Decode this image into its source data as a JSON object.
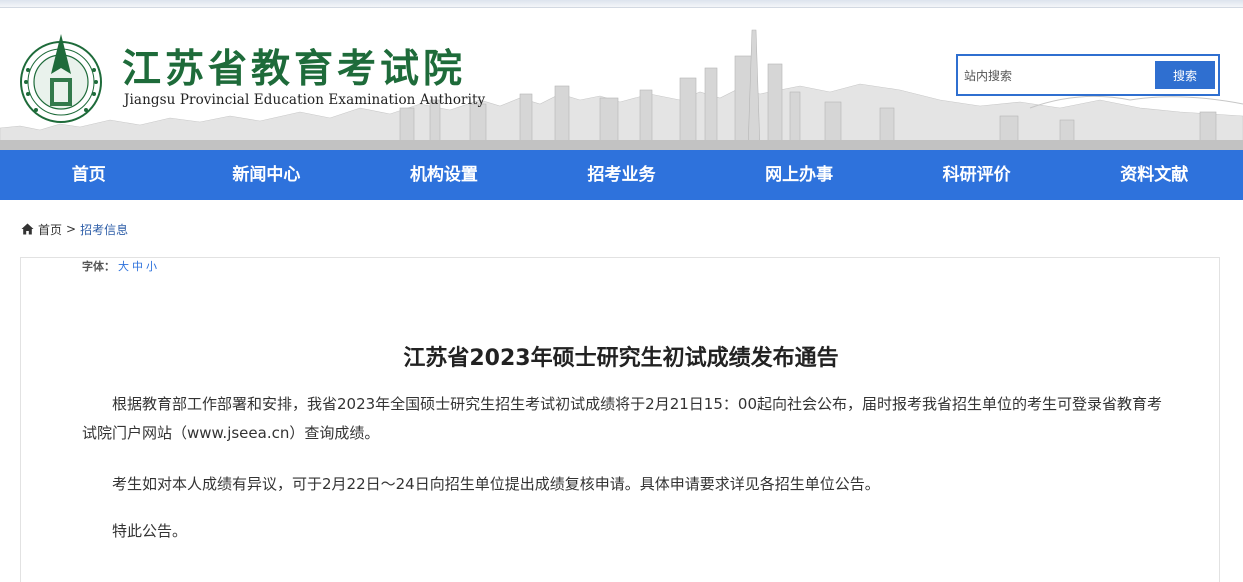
{
  "header": {
    "title_cn": "江苏省教育考试院",
    "title_en": "Jiangsu Provincial Education Examination Authority",
    "search_placeholder": "站内搜索",
    "search_button": "搜索"
  },
  "nav": {
    "items": [
      {
        "label": "首页"
      },
      {
        "label": "新闻中心"
      },
      {
        "label": "机构设置"
      },
      {
        "label": "招考业务"
      },
      {
        "label": "网上办事"
      },
      {
        "label": "科研评价"
      },
      {
        "label": "资料文献"
      }
    ]
  },
  "breadcrumb": {
    "home": "首页",
    "separator": ">",
    "current": "招考信息"
  },
  "font_size": {
    "label": "字体：",
    "options": [
      "大",
      "中",
      "小"
    ]
  },
  "article": {
    "title": "江苏省2023年硕士研究生初试成绩发布通告",
    "paragraphs": [
      "根据教育部工作部署和安排，我省2023年全国硕士研究生招生考试初试成绩将于2月21日15：00起向社会公布，届时报考我省招生单位的考生可登录省教育考试院门户网站（www.jseea.cn）查询成绩。",
      "考生如对本人成绩有异议，可于2月22日～24日向招生单位提出成绩复核申请。具体申请要求详见各招生单位公告。",
      "特此公告。"
    ]
  },
  "colors": {
    "nav_blue": "#2e72dc",
    "logo_green": "#1e6b3a",
    "link_blue": "#2e5ea8"
  },
  "icons": {
    "home": "home-icon",
    "emblem": "emblem-icon"
  }
}
